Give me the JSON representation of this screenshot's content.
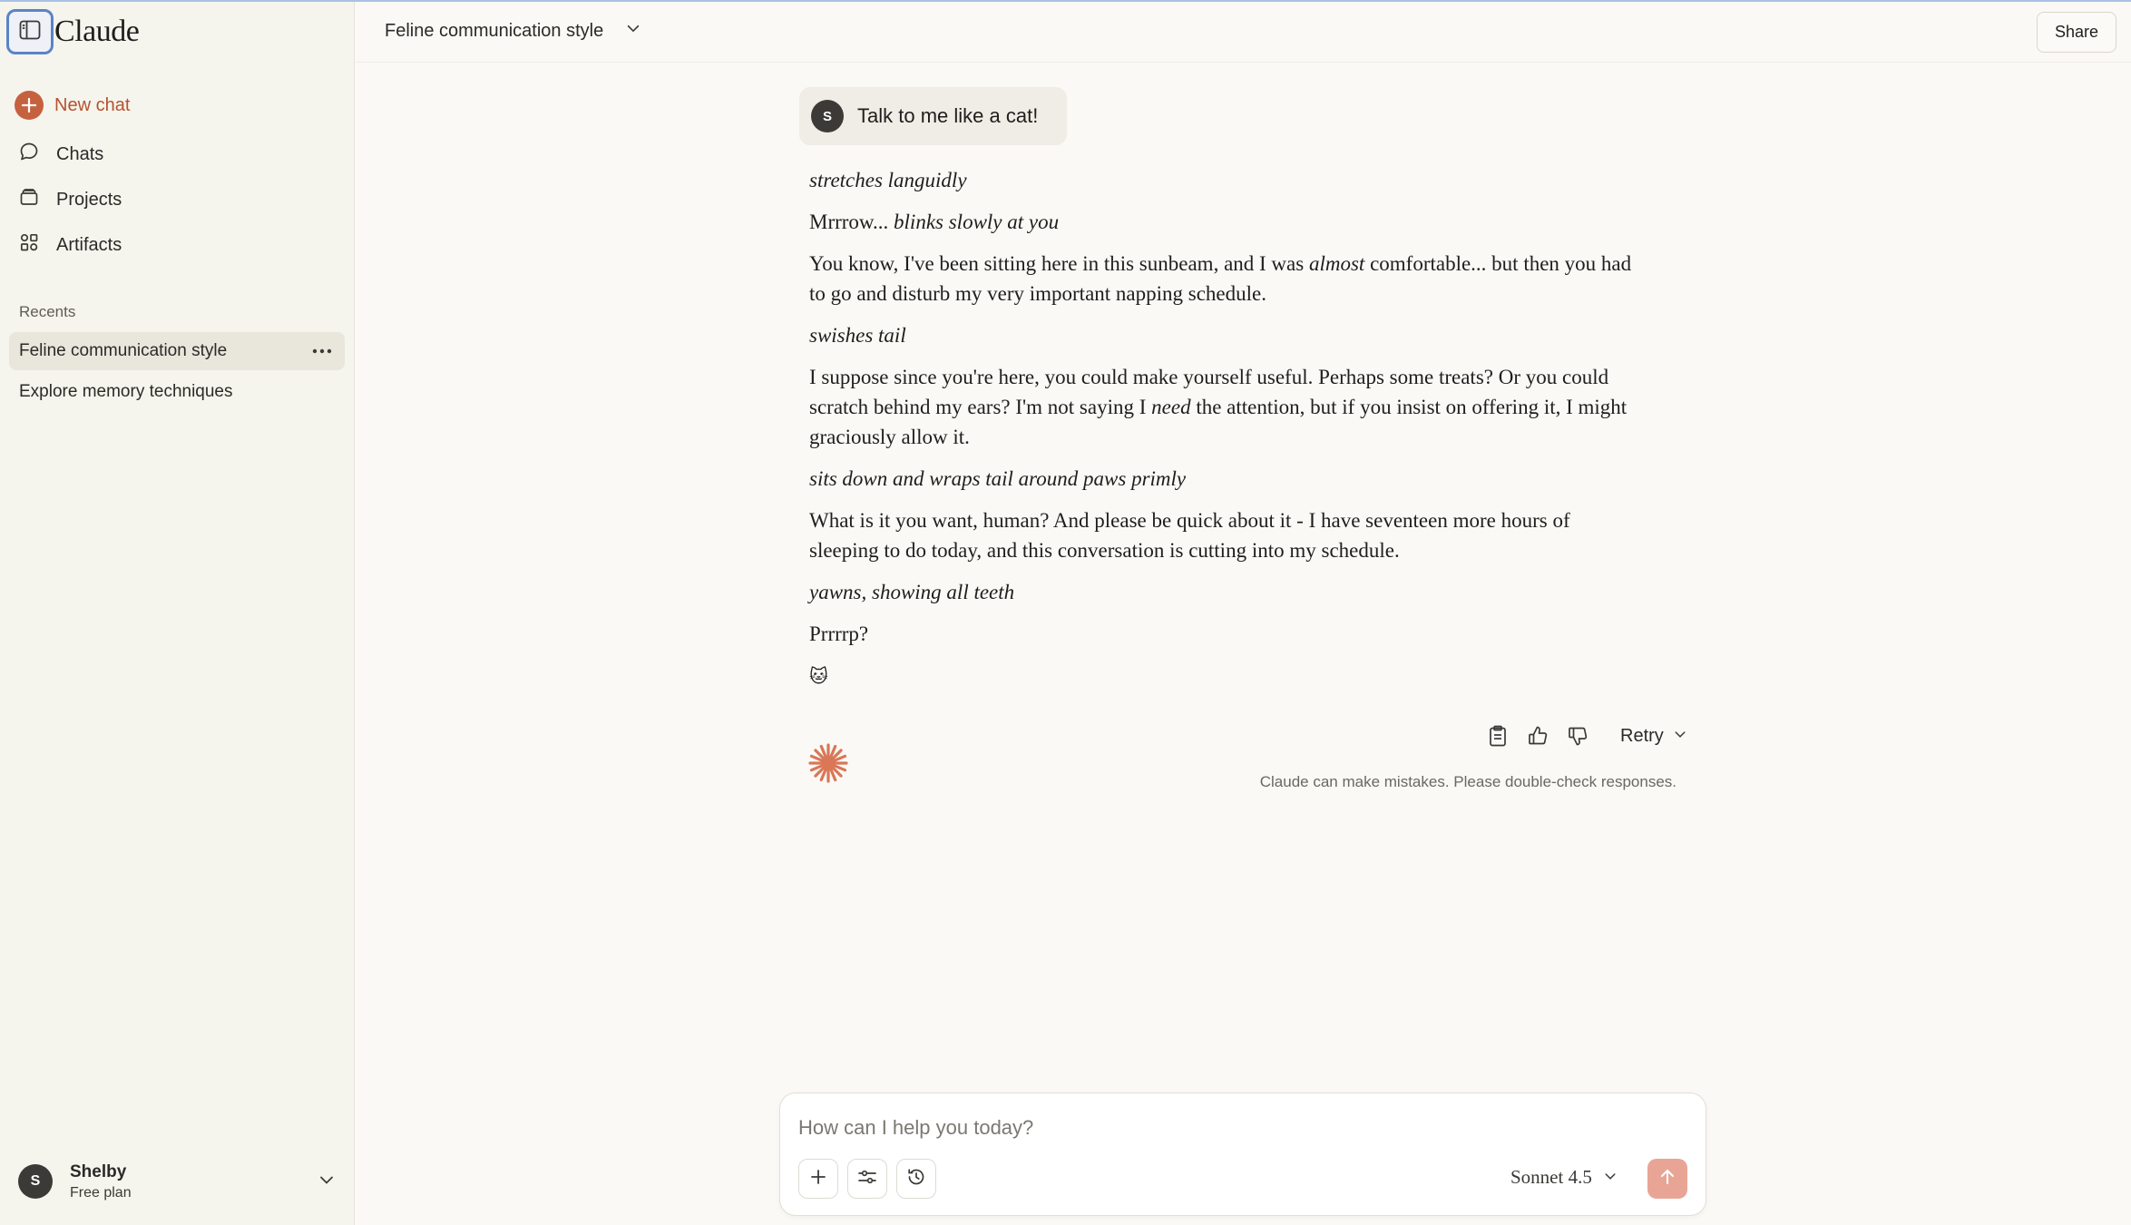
{
  "app": {
    "brand": "Claude"
  },
  "sidebar": {
    "new_chat": "New chat",
    "nav": [
      {
        "label": "Chats",
        "icon": "chat-bubble-icon"
      },
      {
        "label": "Projects",
        "icon": "folder-stack-icon"
      },
      {
        "label": "Artifacts",
        "icon": "artifacts-grid-icon"
      }
    ],
    "recents_heading": "Recents",
    "recents": [
      {
        "label": "Feline communication style",
        "active": true
      },
      {
        "label": "Explore memory techniques",
        "active": false
      }
    ],
    "user": {
      "initial": "S",
      "name": "Shelby",
      "plan": "Free plan"
    }
  },
  "header": {
    "title": "Feline communication style",
    "share": "Share"
  },
  "conversation": {
    "user_message": {
      "initial": "S",
      "text": "Talk to me like a cat!"
    },
    "reply": {
      "p1": "stretches languidly",
      "p2_a": "Mrrrow... ",
      "p2_b": "blinks slowly at you",
      "p3_a": "You know, I've been sitting here in this sunbeam, and I was ",
      "p3_b": "almost",
      "p3_c": " comfortable... but then you had to go and disturb my very important napping schedule.",
      "p4": "swishes tail",
      "p5_a": "I suppose since you're here, you could make yourself useful. Perhaps some treats? Or you could scratch behind my ears? I'm not saying I ",
      "p5_b": "need",
      "p5_c": " the attention, but if you insist on offering it, I might graciously allow it.",
      "p6": "sits down and wraps tail around paws primly",
      "p7": "What is it you want, human? And please be quick about it - I have seventeen more hours of sleeping to do today, and this conversation is cutting into my schedule.",
      "p8": "yawns, showing all teeth",
      "p9": "Prrrrp?",
      "p10": "🐱"
    },
    "actions": {
      "retry": "Retry"
    },
    "disclaimer": "Claude can make mistakes. Please double-check responses."
  },
  "composer": {
    "placeholder": "How can I help you today?",
    "value": "",
    "model": "Sonnet 4.5"
  },
  "colors": {
    "accent": "#c6613f",
    "send_disabled": "#e8a595",
    "sidebar_bg": "#f5f4ed",
    "main_bg": "#faf9f5"
  }
}
